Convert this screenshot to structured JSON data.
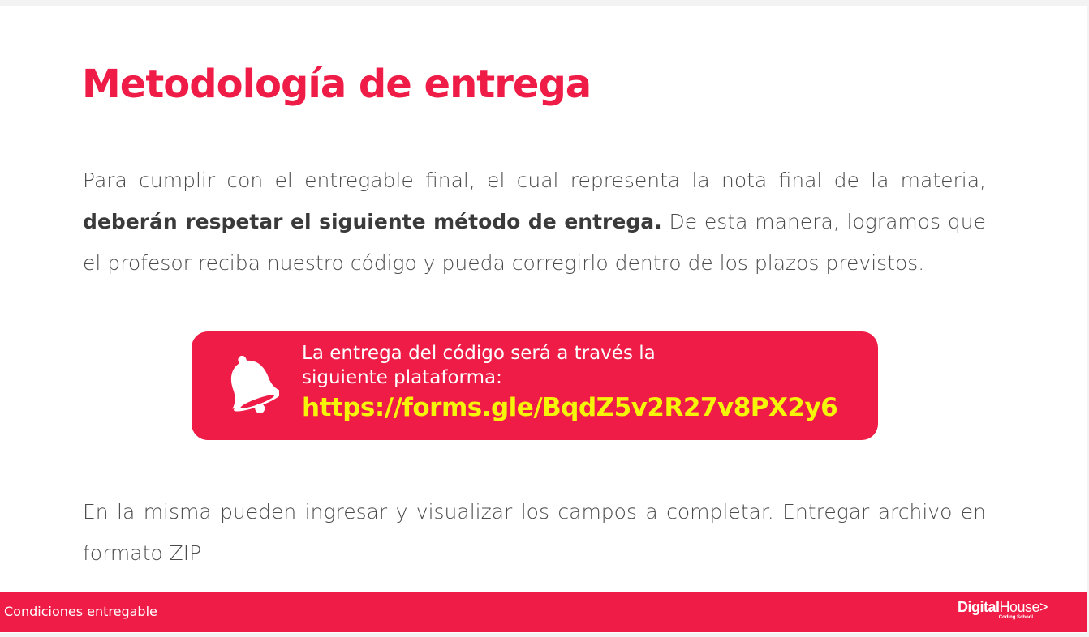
{
  "slide": {
    "title": "Metodología de entrega",
    "paragraph1": {
      "text_before": "Para cumplir con el entregable final, el cual representa la nota final de la materia, ",
      "bold": "deberán respetar el siguiente método de entrega.",
      "text_after": " De esta manera, logramos que el profesor reciba nuestro código y pueda corregirlo dentro de los plazos previstos."
    },
    "callout": {
      "icon": "bell-icon",
      "line1": "La entrega del código será a través la",
      "line2": "siguiente plataforma:",
      "link": "https://forms.gle/BqdZ5v2R27v8PX2y6"
    },
    "paragraph2": "En la misma pueden ingresar y visualizar los campos a completar. Entregar archivo en formato ZIP"
  },
  "footer": {
    "label": "Condiciones entregable",
    "logo_digital": "Digital",
    "logo_house": "House",
    "logo_arrow": ">",
    "logo_sub": "Coding School"
  },
  "colors": {
    "accent": "#ee1c46",
    "link": "#f5f50a",
    "body_text": "#4a4a4a"
  }
}
